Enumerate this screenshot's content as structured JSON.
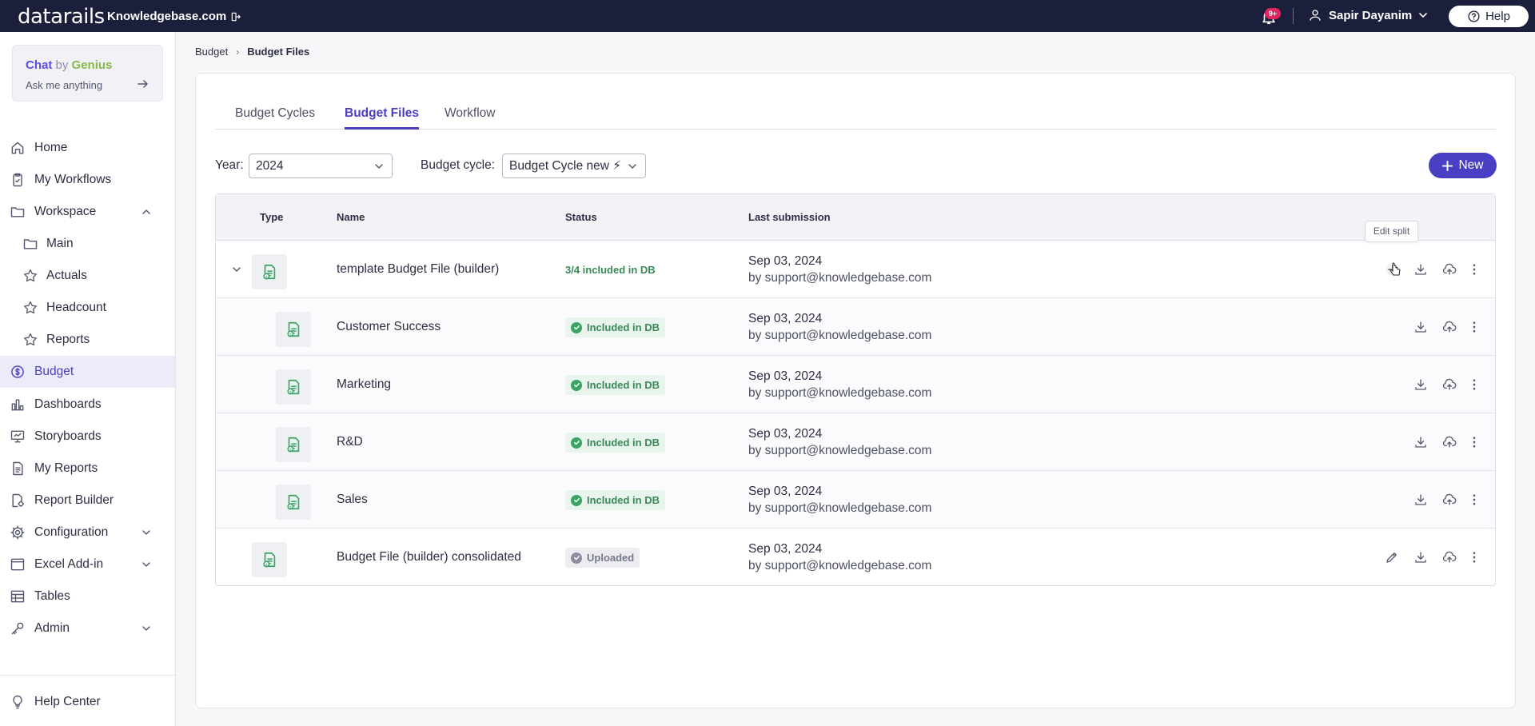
{
  "topbar": {
    "logo": "datarails",
    "company": "Knowledgebase.com",
    "notification_badge": "9+",
    "user_name": "Sapir Dayanim",
    "help_label": "Help"
  },
  "sidebar": {
    "chat": {
      "title_chat": "Chat",
      "title_by": "by",
      "title_genius": "Genius",
      "subtitle": "Ask me anything"
    },
    "items": [
      {
        "label": "Home",
        "icon": "home-icon"
      },
      {
        "label": "My Workflows",
        "icon": "clipboard-icon"
      },
      {
        "label": "Workspace",
        "icon": "folder-icon"
      },
      {
        "label": "Main",
        "icon": "folder-icon"
      },
      {
        "label": "Actuals",
        "icon": "star-icon"
      },
      {
        "label": "Headcount",
        "icon": "star-icon"
      },
      {
        "label": "Reports",
        "icon": "star-icon"
      },
      {
        "label": "Budget",
        "icon": "budget-icon"
      },
      {
        "label": "Dashboards",
        "icon": "bar-chart-icon"
      },
      {
        "label": "Storyboards",
        "icon": "presentation-icon"
      },
      {
        "label": "My Reports",
        "icon": "report-icon"
      },
      {
        "label": "Report Builder",
        "icon": "report-builder-icon"
      },
      {
        "label": "Configuration",
        "icon": "gear-icon"
      },
      {
        "label": "Excel Add-in",
        "icon": "window-icon"
      },
      {
        "label": "Tables",
        "icon": "table-icon"
      },
      {
        "label": "Admin",
        "icon": "key-icon"
      }
    ],
    "help_center": "Help Center"
  },
  "breadcrumb": {
    "parent": "Budget",
    "current": "Budget Files"
  },
  "tabs": [
    "Budget Cycles",
    "Budget Files",
    "Workflow"
  ],
  "filters": {
    "year_label": "Year:",
    "year_value": "2024",
    "cycle_label": "Budget cycle:",
    "cycle_value": "Budget Cycle new ⚡"
  },
  "new_button": "New",
  "table": {
    "headers": {
      "type": "Type",
      "name": "Name",
      "status": "Status",
      "last_submission": "Last submission"
    },
    "rows": [
      {
        "name": "template Budget File (builder)",
        "status": "3/4 included in DB",
        "date": "Sep 03, 2024",
        "by": "by support@knowledgebase.com"
      },
      {
        "name": "Customer Success",
        "status": "Included in DB",
        "date": "Sep 03, 2024",
        "by": "by support@knowledgebase.com"
      },
      {
        "name": "Marketing",
        "status": "Included in DB",
        "date": "Sep 03, 2024",
        "by": "by support@knowledgebase.com"
      },
      {
        "name": "R&D",
        "status": "Included in DB",
        "date": "Sep 03, 2024",
        "by": "by support@knowledgebase.com"
      },
      {
        "name": "Sales",
        "status": "Included in DB",
        "date": "Sep 03, 2024",
        "by": "by support@knowledgebase.com"
      },
      {
        "name": "Budget File (builder) consolidated",
        "status": "Uploaded",
        "date": "Sep 03, 2024",
        "by": "by support@knowledgebase.com"
      }
    ]
  },
  "tooltip": "Edit split",
  "colors": {
    "accent": "#4a3fc4",
    "topbar": "#1b1f3b",
    "success": "#3a8a57",
    "badge_red": "#e0245e"
  }
}
